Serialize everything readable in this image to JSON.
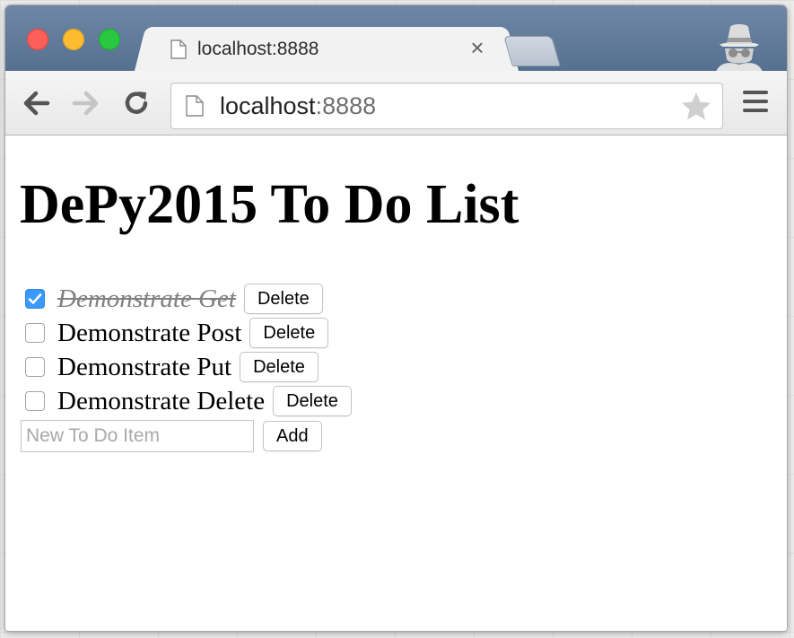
{
  "browser": {
    "tab_title": "localhost:8888",
    "tab_close": "×",
    "url_host": "localhost",
    "url_port": ":8888"
  },
  "page": {
    "heading": "DePy2015 To Do List",
    "todos": [
      {
        "text": "Demonstrate Get",
        "done": true,
        "delete_label": "Delete"
      },
      {
        "text": "Demonstrate Post",
        "done": false,
        "delete_label": "Delete"
      },
      {
        "text": "Demonstrate Put",
        "done": false,
        "delete_label": "Delete"
      },
      {
        "text": "Demonstrate Delete",
        "done": false,
        "delete_label": "Delete"
      }
    ],
    "new_item": {
      "value": "",
      "placeholder": "New To Do Item"
    },
    "add_label": "Add"
  },
  "colors": {
    "checkbox_checked": "#3b99fc",
    "done_text": "#808080",
    "titlebar": "#6e87a6"
  }
}
